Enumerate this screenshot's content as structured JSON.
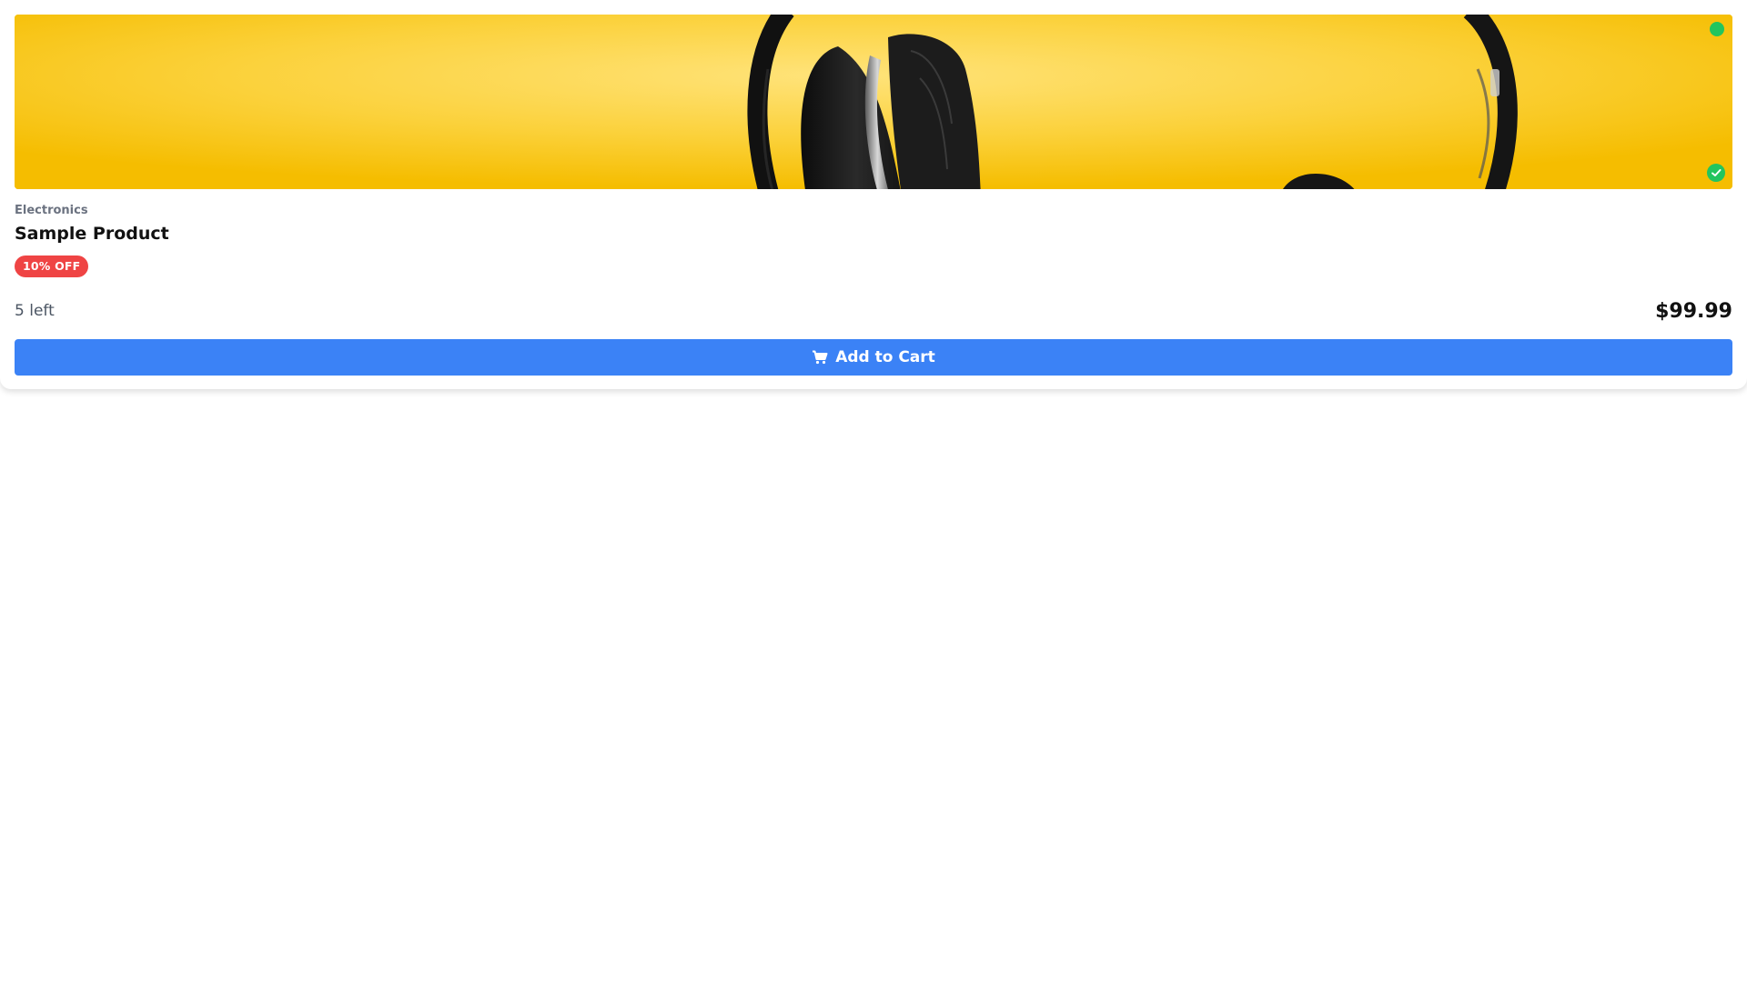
{
  "product": {
    "image_subject": "headphones-on-yellow",
    "category": "Electronics",
    "name": "Sample Product",
    "discount_badge": "10% OFF",
    "stock": "5 left",
    "price": "$99.99",
    "add_to_cart_label": "Add to Cart",
    "cart_icon": "cart-icon",
    "status_icon": "check-circle-icon"
  },
  "colors": {
    "background": "#ffffff",
    "hero_yellow": "#f7c000",
    "status_green": "#22c55e",
    "discount_red": "#ef4444",
    "button_blue": "#3b82f6",
    "category_gray": "#6b7280"
  }
}
